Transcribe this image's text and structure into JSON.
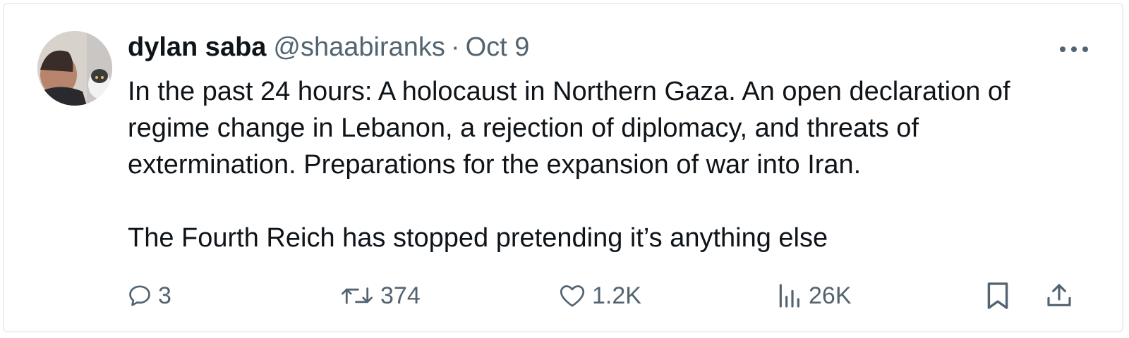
{
  "author": {
    "display_name": "dylan saba",
    "handle": "@shaabiranks",
    "separator": "·",
    "date": "Oct 9",
    "avatar_icon": "profile-photo"
  },
  "post": {
    "paragraphs": [
      "In the past 24 hours: A holocaust in Northern Gaza. An open declaration of regime change in Lebanon, a rejection of diplomacy, and threats of extermination. Preparations for the expansion of war into Iran.",
      "The Fourth Reich has stopped pretending it’s anything else"
    ]
  },
  "actions": {
    "replies": "3",
    "reposts": "374",
    "likes": "1.2K",
    "views": "26K"
  },
  "icons": {
    "reply": "speech-bubble-icon",
    "repost": "repost-arrows-icon",
    "like": "heart-icon",
    "views": "bar-chart-icon",
    "bookmark": "bookmark-icon",
    "share": "share-upload-icon",
    "more": "ellipsis-icon"
  },
  "colors": {
    "text": "#0f1419",
    "secondary": "#536471",
    "border": "#eceff1"
  }
}
